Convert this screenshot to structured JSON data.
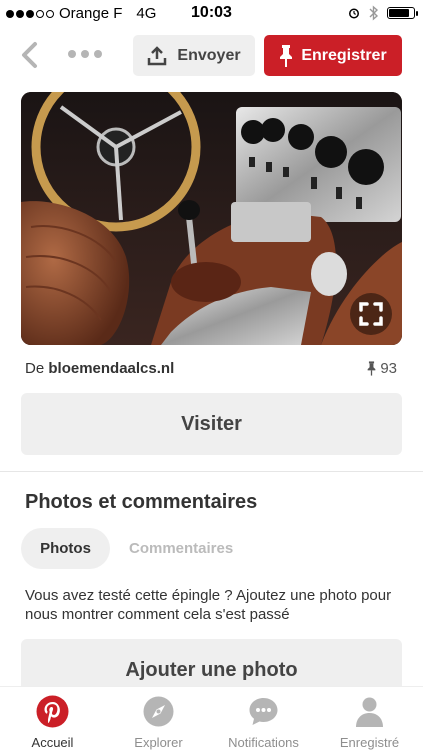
{
  "status_bar": {
    "carrier": "Orange F",
    "network": "4G",
    "time": "10:03",
    "signal_strength": "3 of 5",
    "battery_level": 0.85
  },
  "top_bar": {
    "back_icon": "chevron-left-icon",
    "more_icon": "more-dots-icon",
    "send_label": "Envoyer",
    "save_label": "Enregistrer",
    "save_color": "#cb1f27"
  },
  "pin": {
    "source_prefix": "De",
    "source_domain": "bloemendaalcs.nl",
    "saves_count": "93",
    "visit_label": "Visiter"
  },
  "photos_section": {
    "title": "Photos et commentaires",
    "tabs": [
      {
        "label": "Photos",
        "active": true
      },
      {
        "label": "Commentaires",
        "active": false
      }
    ],
    "prompt": "Vous avez testé cette épingle ? Ajoutez une photo pour nous montrer comment cela s'est passé",
    "add_photo_label": "Ajouter une photo"
  },
  "bottom_nav": {
    "items": [
      {
        "label": "Accueil",
        "icon": "pinterest-logo-icon",
        "active": true
      },
      {
        "label": "Explorer",
        "icon": "compass-icon",
        "active": false
      },
      {
        "label": "Notifications",
        "icon": "speech-bubble-icon",
        "active": false
      },
      {
        "label": "Enregistré",
        "icon": "person-icon",
        "active": false
      }
    ]
  }
}
